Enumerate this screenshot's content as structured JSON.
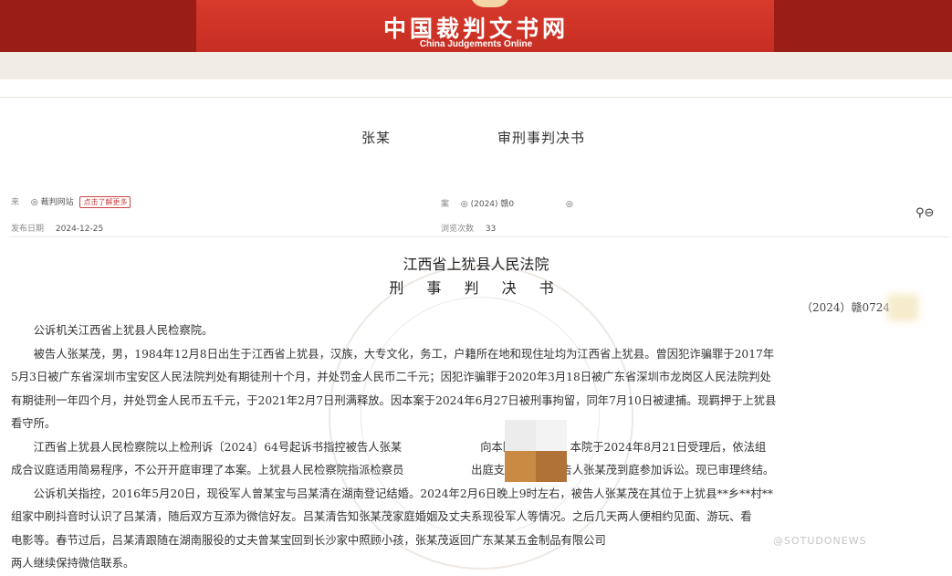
{
  "header": {
    "site_title": "中国裁判文书网",
    "site_subtitle": "China Judgements Online"
  },
  "doc_header": {
    "party": "张某",
    "doc_kind": "审刑事判决书"
  },
  "meta": {
    "row1_left_label": "来",
    "row1_left_value": "◎ 裁判网站",
    "row1_tag": "点击了解更多",
    "row1_right_label": "案",
    "row1_right_value": "◎ (2024) 赣0",
    "row1_right_suffix": "◎",
    "publish_label": "发布日期",
    "publish_value": "2024-12-25",
    "views_label": "浏览次数",
    "views_value": "33"
  },
  "tools": {
    "icons": [
      "share-icon",
      "print-icon"
    ],
    "glyph": "⚲⊖"
  },
  "document": {
    "court": "江西省上犹县人民法院",
    "type": "刑 事 判 决 书",
    "case_number": "（2024）赣0724",
    "paragraphs": [
      {
        "indent": true,
        "text": "公诉机关江西省上犹县人民检察院。"
      },
      {
        "indent": true,
        "text": "被告人张某茂，男，1984年12月8日出生于江西省上犹县，汉族，大专文化，务工，户籍所在地和现住址均为江西省上犹县。曾因犯诈骗罪于2017年"
      },
      {
        "indent": false,
        "text": "5月3日被广东省深圳市宝安区人民法院判处有期徒刑十个月，并处罚金人民币二千元；因犯诈骗罪于2020年3月18日被广东省深圳市龙岗区人民法院判处"
      },
      {
        "indent": false,
        "text": "有期徒刑一年四个月，并处罚金人民币五千元，于2021年2月7日刑满释放。因本案于2024年6月27日被刑事拘留，同年7月10日被逮捕。现羁押于上犹县"
      },
      {
        "indent": false,
        "text": "看守所。"
      },
      {
        "indent": true,
        "text": "江西省上犹县人民检察院以上检刑诉〔2024〕64号起诉书指控被告人张某　　　　　　　向本院提起公诉。本院于2024年8月21日受理后，依法组"
      },
      {
        "indent": false,
        "text": "成合议庭适用简易程序，不公开开庭审理了本案。上犹县人民检察院指派检察员　　　　　　出庭支持公诉，被告人张某茂到庭参加诉讼。现已审理终结。"
      },
      {
        "indent": true,
        "text": "公诉机关指控，2016年5月20日，现役军人曾某宝与吕某清在湖南登记结婚。2024年2月6日晚上9时左右，被告人张某茂在其位于上犹县**乡**村**"
      },
      {
        "indent": false,
        "text": "组家中刷抖音时认识了吕某清，随后双方互添为微信好友。吕某清告知张某茂家庭婚姻及丈夫系现役军人等情况。之后几天两人便相约见面、游玩、看"
      },
      {
        "indent": false,
        "text": "电影等。春节过后，吕某清跟随在湖南服役的丈夫曾某宝回到长沙家中照顾小孩，张某茂返回广东某某五金制品有限公司"
      },
      {
        "indent": false,
        "text": "两人继续保持微信联系。"
      }
    ]
  },
  "watermark_text": "@SOTUDONEWS",
  "colors": {
    "banner_red": "#c52e22",
    "banner_dark": "#9a1d17",
    "subbar": "#f2ede4"
  }
}
